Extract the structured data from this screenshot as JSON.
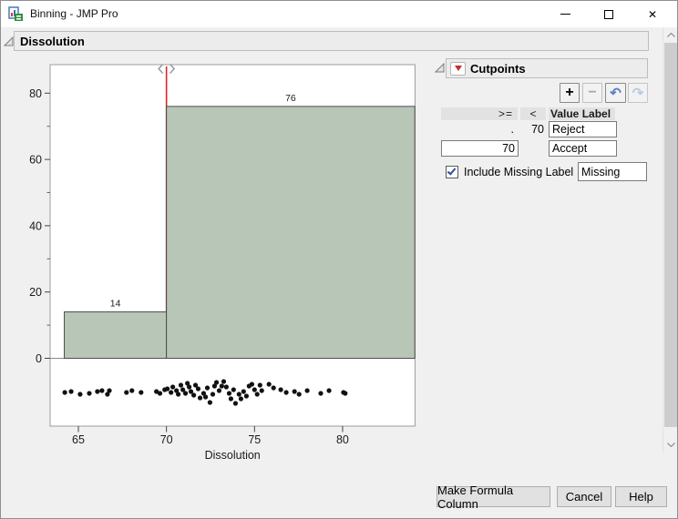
{
  "window": {
    "title": "Binning - JMP Pro",
    "controls": {
      "close_glyph": "✕"
    }
  },
  "sections": {
    "dissolution": "Dissolution",
    "cutpoints": "Cutpoints"
  },
  "chart_data": {
    "type": "histogram",
    "title": "Dissolution",
    "xlabel": "Dissolution",
    "ylabel": "",
    "xlim": [
      63.4,
      84.1
    ],
    "ylim": [
      0,
      88.6
    ],
    "x_ticks": [
      65,
      70,
      75,
      80
    ],
    "y_ticks": [
      0,
      20,
      40,
      60,
      80
    ],
    "y_minor_ticks": [
      10,
      30,
      50,
      70
    ],
    "grid": "off",
    "bars": [
      {
        "from": 64.2,
        "to": 70,
        "count": 14
      },
      {
        "from": 70,
        "to": 84.1,
        "count": 76
      }
    ],
    "cutpoint": 70,
    "bar_fill": "#b8c6b8",
    "bar_stroke": "#4d4d4d",
    "cutpoint_color": "#e02424",
    "jitter_points": [
      [
        64.23,
        1
      ],
      [
        64.59,
        0
      ],
      [
        65.1,
        3
      ],
      [
        65.62,
        2
      ],
      [
        66.08,
        0
      ],
      [
        66.34,
        -1
      ],
      [
        66.65,
        3
      ],
      [
        66.76,
        -1
      ],
      [
        67.73,
        1
      ],
      [
        68.04,
        -1
      ],
      [
        68.56,
        1
      ],
      [
        69.43,
        0
      ],
      [
        69.63,
        2
      ],
      [
        69.9,
        -2
      ],
      [
        70.05,
        -3
      ],
      [
        70.26,
        1
      ],
      [
        70.36,
        -5
      ],
      [
        70.57,
        -1
      ],
      [
        70.67,
        3
      ],
      [
        70.82,
        -7
      ],
      [
        70.93,
        -2
      ],
      [
        71.08,
        2
      ],
      [
        71.19,
        -9
      ],
      [
        71.29,
        -5
      ],
      [
        71.39,
        0
      ],
      [
        71.55,
        4
      ],
      [
        71.65,
        -7
      ],
      [
        71.8,
        -3
      ],
      [
        71.91,
        7
      ],
      [
        72.11,
        2
      ],
      [
        72.22,
        6
      ],
      [
        72.32,
        -4
      ],
      [
        72.47,
        12
      ],
      [
        72.63,
        3
      ],
      [
        72.73,
        -6
      ],
      [
        72.84,
        -10
      ],
      [
        72.99,
        -1
      ],
      [
        73.14,
        -6
      ],
      [
        73.25,
        -11
      ],
      [
        73.4,
        -5
      ],
      [
        73.56,
        2
      ],
      [
        73.66,
        8
      ],
      [
        73.81,
        -2
      ],
      [
        73.92,
        13
      ],
      [
        74.12,
        3
      ],
      [
        74.23,
        8
      ],
      [
        74.38,
        0
      ],
      [
        74.54,
        5
      ],
      [
        74.69,
        -6
      ],
      [
        74.85,
        -8
      ],
      [
        75.0,
        -2
      ],
      [
        75.15,
        3
      ],
      [
        75.31,
        -7
      ],
      [
        75.41,
        -1
      ],
      [
        75.82,
        -8
      ],
      [
        76.08,
        -4
      ],
      [
        76.49,
        -2
      ],
      [
        76.8,
        1
      ],
      [
        77.27,
        0
      ],
      [
        77.53,
        3
      ],
      [
        77.99,
        -1
      ],
      [
        78.76,
        2
      ],
      [
        79.23,
        -1
      ],
      [
        80.05,
        1
      ],
      [
        80.15,
        2
      ]
    ]
  },
  "cutpoints_panel": {
    "toolbar": {
      "add": "+",
      "remove": "−",
      "undo": "↶",
      "redo": "↷"
    },
    "table": {
      "headers": {
        "ge": ">=",
        "lt": "<",
        "label": "Value Label"
      },
      "rows": [
        {
          "ge": ".",
          "lt": "70",
          "label": "Reject"
        },
        {
          "ge": "70",
          "lt": "",
          "label": "Accept"
        }
      ]
    },
    "include_missing": {
      "label": "Include Missing Label",
      "checked": true,
      "value": "Missing"
    }
  },
  "footer": {
    "make_formula_label": "Make Formula Column",
    "cancel_label": "Cancel",
    "help_label": "Help"
  }
}
